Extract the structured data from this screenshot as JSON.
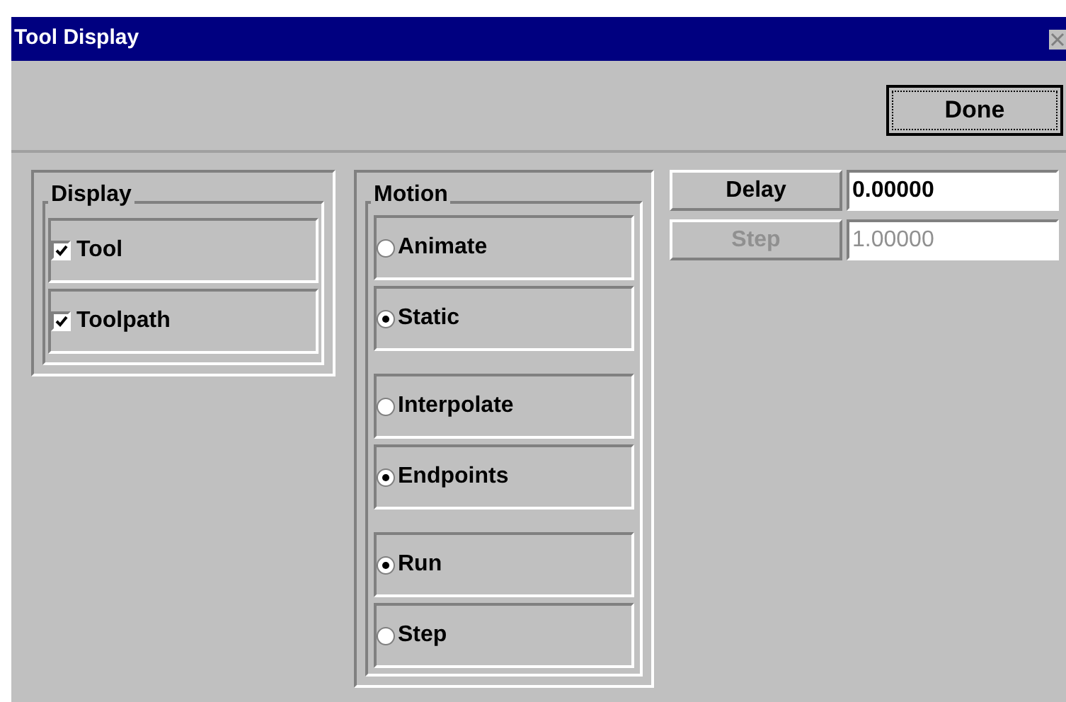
{
  "window": {
    "title": "Tool Display"
  },
  "done_button": {
    "label": "Done"
  },
  "display": {
    "title": "Display",
    "items": [
      {
        "label": "Tool",
        "checked": true
      },
      {
        "label": "Toolpath",
        "checked": true
      }
    ]
  },
  "motion": {
    "title": "Motion",
    "groups": [
      [
        {
          "label": "Animate",
          "selected": false
        },
        {
          "label": "Static",
          "selected": true
        }
      ],
      [
        {
          "label": "Interpolate",
          "selected": false
        },
        {
          "label": "Endpoints",
          "selected": true
        }
      ],
      [
        {
          "label": "Run",
          "selected": true
        },
        {
          "label": "Step",
          "selected": false
        }
      ]
    ]
  },
  "params": [
    {
      "label": "Delay",
      "value": "0.00000",
      "disabled": false
    },
    {
      "label": "Step",
      "value": "1.00000",
      "disabled": true
    }
  ]
}
